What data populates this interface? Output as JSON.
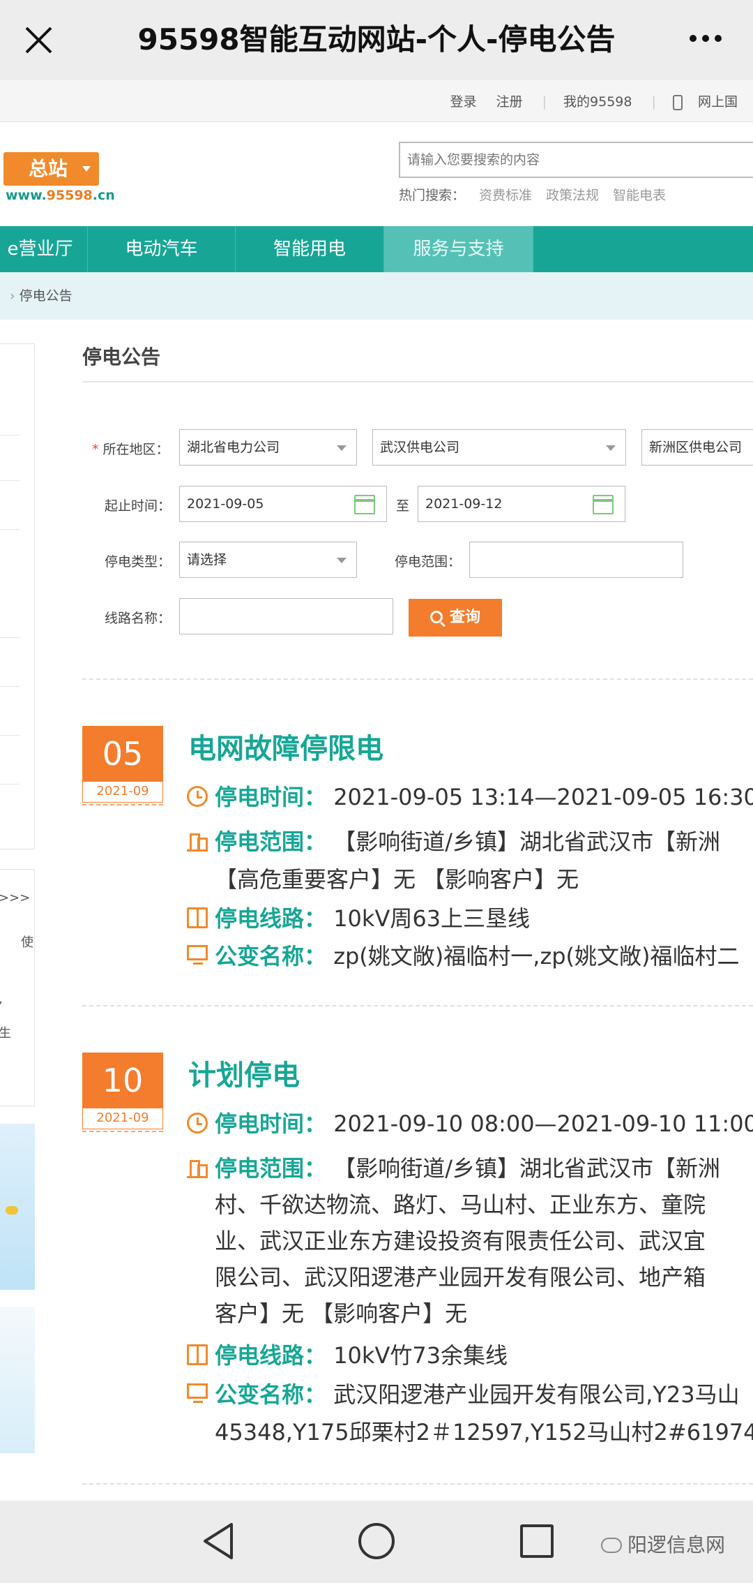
{
  "window": {
    "title": "95598智能互动网站-个人-停电公告"
  },
  "top_links": [
    "登录",
    "注册",
    "我的95598",
    "网上国"
  ],
  "header": {
    "logo_text": "总站",
    "logo_url_prefix": "www.",
    "logo_url_hl": "95598",
    "logo_url_suffix": ".cn",
    "search_placeholder": "请输入您要搜索的内容",
    "hot_label": "热门搜索：",
    "hot_items": [
      "资费标准",
      "政策法规",
      "智能电表"
    ]
  },
  "nav": {
    "items": [
      "e营业厅",
      "电动汽车",
      "智能用电",
      "服务与支持"
    ],
    "active_index": 3
  },
  "breadcrumb": {
    "current": "停电公告"
  },
  "sidebar": {
    "fragments": [
      ">>>",
      "使",
      ",",
      "生"
    ]
  },
  "main": {
    "title": "停电公告"
  },
  "form": {
    "region_label": "所在地区：",
    "region_required_mark": "*",
    "region_values": [
      "湖北省电力公司",
      "武汉供电公司",
      "新洲区供电公司"
    ],
    "time_label": "起止时间：",
    "start_date": "2021-09-05",
    "to_label": "至",
    "end_date": "2021-09-12",
    "type_label": "停电类型：",
    "type_value": "请选择",
    "scope_label": "停电范围：",
    "scope_value": "",
    "line_label": "线路名称：",
    "line_value": "",
    "query_button": "查询"
  },
  "notices": [
    {
      "day": "05",
      "year_month": "2021-09",
      "title": "电网故障停限电",
      "time_key": "停电时间：",
      "time_val": "2021-09-05 13:14—2021-09-05 16:30",
      "scope_key": "停电范围：",
      "scope_lines": [
        "【影响街道/乡镇】湖北省武汉市【新洲",
        "【高危重要客户】无 【影响客户】无"
      ],
      "line_key": "停电线路：",
      "line_val": "10kV周63上三垦线",
      "station_key": "公变名称：",
      "station_lines": [
        "zp(姚文敞)福临村一,zp(姚文敞)福临村二"
      ]
    },
    {
      "day": "10",
      "year_month": "2021-09",
      "title": "计划停电",
      "time_key": "停电时间：",
      "time_val": "2021-09-10 08:00—2021-09-10 11:00",
      "scope_key": "停电范围：",
      "scope_lines": [
        "【影响街道/乡镇】湖北省武汉市【新洲",
        "村、千欲达物流、路灯、马山村、正业东方、童院",
        "业、武汉正业东方建设投资有限责任公司、武汉宜",
        "限公司、武汉阳逻港产业园开发有限公司、地产箱",
        "客户】无 【影响客户】无"
      ],
      "line_key": "停电线路：",
      "line_val": "10kV竹73余集线",
      "station_key": "公变名称：",
      "station_lines": [
        "武汉阳逻港产业园开发有限公司,Y23马山",
        "45348,Y175邱栗村2＃12597,Y152马山村2#61974,"
      ]
    }
  ],
  "system_bar": {
    "watermark": "阳逻信息网"
  }
}
